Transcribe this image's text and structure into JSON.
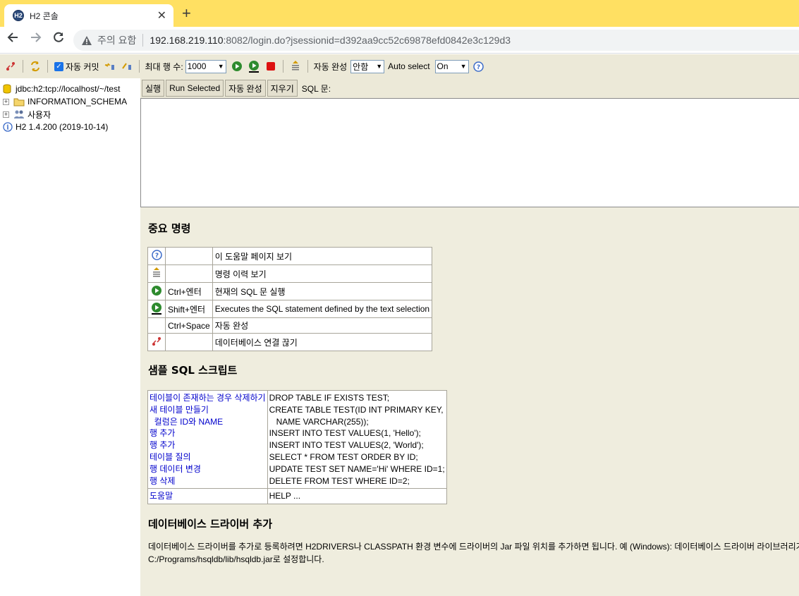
{
  "browser": {
    "tab_title": "H2 콘솔",
    "tab_favicon_text": "H2",
    "new_tab": "+",
    "close": "✕",
    "security_warning": "주의 요함",
    "url_host": "192.168.219.110",
    "url_rest": ":8082/login.do?jsessionid=d392aa9cc52c69878efd0842e3c129d3"
  },
  "toolbar": {
    "auto_commit_label": "자동 커밋",
    "max_rows_label": "최대 행 수:",
    "max_rows_value": "1000",
    "autocomplete_label": "자동 완성",
    "autocomplete_value": "안함",
    "auto_select_label": "Auto select",
    "auto_select_value": "On"
  },
  "tree": {
    "connection": "jdbc:h2:tcp://localhost/~/test",
    "schema": "INFORMATION_SCHEMA",
    "users": "사용자",
    "version": "H2 1.4.200 (2019-10-14)"
  },
  "query": {
    "run": "실행",
    "run_selected": "Run Selected",
    "autocomplete": "자동 완성",
    "clear": "지우기",
    "sql_label": "SQL 문:"
  },
  "help": {
    "important_title": "중요 명령",
    "commands": [
      {
        "icon": "help-icon",
        "key": "",
        "desc": "이 도움말 페이지 보기"
      },
      {
        "icon": "history-icon",
        "key": "",
        "desc": "명령 이력 보기"
      },
      {
        "icon": "run-icon",
        "key": "Ctrl+엔터",
        "desc": "현재의 SQL 문 실행"
      },
      {
        "icon": "run-selected-icon",
        "key": "Shift+엔터",
        "desc": "Executes the SQL statement defined by the text selection"
      },
      {
        "icon": "",
        "key": "Ctrl+Space",
        "desc": "자동 완성"
      },
      {
        "icon": "disconnect-icon",
        "key": "",
        "desc": "데이터베이스 연결 끊기"
      }
    ],
    "sample_title": "샘플 SQL 스크립트",
    "samples": [
      {
        "label": "테이블이 존재하는 경우 삭제하기",
        "sql": "DROP TABLE IF EXISTS TEST;"
      },
      {
        "label": "새 테이블 만들기",
        "sql": "CREATE TABLE TEST(ID INT PRIMARY KEY,"
      },
      {
        "label": "  컬럼은 ID와 NAME",
        "sql": "   NAME VARCHAR(255));"
      },
      {
        "label": "행 추가",
        "sql": "INSERT INTO TEST VALUES(1, 'Hello');"
      },
      {
        "label": "행 추가",
        "sql": "INSERT INTO TEST VALUES(2, 'World');"
      },
      {
        "label": "테이블 질의",
        "sql": "SELECT * FROM TEST ORDER BY ID;"
      },
      {
        "label": "행 데이터 변경",
        "sql": "UPDATE TEST SET NAME='Hi' WHERE ID=1;"
      },
      {
        "label": "행 삭제",
        "sql": "DELETE FROM TEST WHERE ID=2;"
      }
    ],
    "help_label": "도움말",
    "help_sql": "HELP ...",
    "driver_title": "데이터베이스 드라이버 추가",
    "driver_text_1": "데이터베이스 드라이버를 추가로 등록하려면 H2DRIVERS나 CLASSPATH 환경 변수에 드라이버의 Jar 파일 위치를 추가하면 됩니다. 예 (Windows): 데이터베이스 드라이버 라이브러리가",
    "driver_text_2": "C:/Programs/hsqldb/lib/hsqldb.jar로 설정합니다."
  }
}
